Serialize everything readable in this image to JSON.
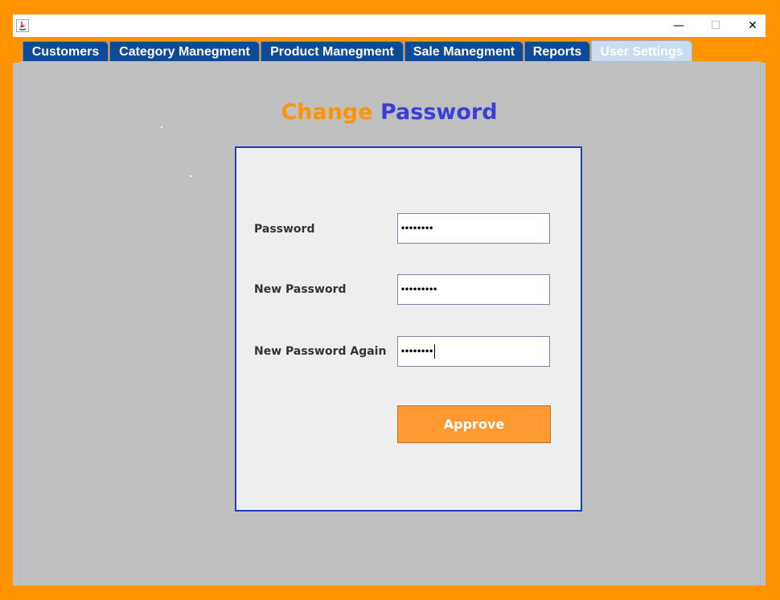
{
  "window": {
    "title": "",
    "controls": {
      "minimize": "—",
      "maximize": "☐",
      "close": "✕"
    }
  },
  "tabs": [
    {
      "label": "Customers"
    },
    {
      "label": "Category Manegment"
    },
    {
      "label": "Product Manegment"
    },
    {
      "label": "Sale Manegment"
    },
    {
      "label": "Reports"
    },
    {
      "label": "User Settings",
      "active": true
    }
  ],
  "heading": {
    "word1": "Change",
    "word2": "Password"
  },
  "form": {
    "password": {
      "label": "Password",
      "value": "••••••••"
    },
    "new_password": {
      "label": "New Password",
      "value": "•••••••••"
    },
    "new_password_again": {
      "label": "New Password Again",
      "value": "••••••••"
    },
    "approve_label": "Approve"
  },
  "colors": {
    "background": "#FF9300",
    "tab": "#0D4A99",
    "tab_active": "#C8DCF2",
    "heading_word1": "#FF9300",
    "heading_word2": "#3B3FD8",
    "panel_border": "#1E3DC7",
    "button": "#FF9A32"
  }
}
